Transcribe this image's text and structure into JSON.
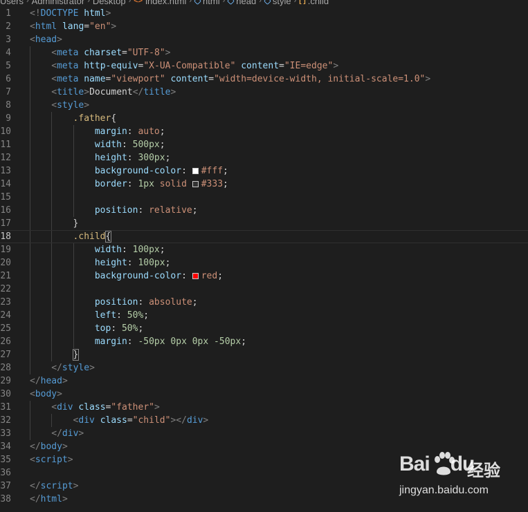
{
  "breadcrumb": {
    "items": [
      {
        "label": "Users",
        "icon": ""
      },
      {
        "label": "Administrator",
        "icon": ""
      },
      {
        "label": "Desktop",
        "icon": ""
      },
      {
        "label": "index.html",
        "icon": "html-file-icon"
      },
      {
        "label": "html",
        "icon": "element-icon"
      },
      {
        "label": "head",
        "icon": "element-icon"
      },
      {
        "label": "style",
        "icon": "element-icon"
      },
      {
        "label": ".child",
        "icon": "css-rule-icon"
      }
    ]
  },
  "editor": {
    "current_line": 18,
    "colors": {
      "background": "#1e1e1e",
      "tag": "#569cd6",
      "attribute": "#9cdcfe",
      "string": "#ce9178",
      "selector": "#d7ba7d",
      "number": "#b5cea8"
    },
    "lines": [
      {
        "n": "1",
        "indent": 0,
        "t": [
          [
            "br",
            "<!"
          ],
          [
            "tag",
            "DOCTYPE"
          ],
          [
            "txt",
            " "
          ],
          [
            "attr",
            "html"
          ],
          [
            "br",
            ">"
          ]
        ]
      },
      {
        "n": "2",
        "indent": 0,
        "t": [
          [
            "br",
            "<"
          ],
          [
            "tag",
            "html"
          ],
          [
            "txt",
            " "
          ],
          [
            "attr",
            "lang"
          ],
          [
            "txt",
            "="
          ],
          [
            "str",
            "\"en\""
          ],
          [
            "br",
            ">"
          ]
        ]
      },
      {
        "n": "3",
        "indent": 0,
        "t": [
          [
            "br",
            "<"
          ],
          [
            "tag",
            "head"
          ],
          [
            "br",
            ">"
          ]
        ]
      },
      {
        "n": "4",
        "indent": 1,
        "t": [
          [
            "br",
            "<"
          ],
          [
            "tag",
            "meta"
          ],
          [
            "txt",
            " "
          ],
          [
            "attr",
            "charset"
          ],
          [
            "txt",
            "="
          ],
          [
            "str",
            "\"UTF-8\""
          ],
          [
            "br",
            ">"
          ]
        ]
      },
      {
        "n": "5",
        "indent": 1,
        "t": [
          [
            "br",
            "<"
          ],
          [
            "tag",
            "meta"
          ],
          [
            "txt",
            " "
          ],
          [
            "attr",
            "http-equiv"
          ],
          [
            "txt",
            "="
          ],
          [
            "str",
            "\"X-UA-Compatible\""
          ],
          [
            "txt",
            " "
          ],
          [
            "attr",
            "content"
          ],
          [
            "txt",
            "="
          ],
          [
            "str",
            "\"IE=edge\""
          ],
          [
            "br",
            ">"
          ]
        ]
      },
      {
        "n": "6",
        "indent": 1,
        "t": [
          [
            "br",
            "<"
          ],
          [
            "tag",
            "meta"
          ],
          [
            "txt",
            " "
          ],
          [
            "attr",
            "name"
          ],
          [
            "txt",
            "="
          ],
          [
            "str",
            "\"viewport\""
          ],
          [
            "txt",
            " "
          ],
          [
            "attr",
            "content"
          ],
          [
            "txt",
            "="
          ],
          [
            "str",
            "\"width=device-width, initial-scale=1.0\""
          ],
          [
            "br",
            ">"
          ]
        ]
      },
      {
        "n": "7",
        "indent": 1,
        "t": [
          [
            "br",
            "<"
          ],
          [
            "tag",
            "title"
          ],
          [
            "br",
            ">"
          ],
          [
            "txt",
            "Document"
          ],
          [
            "br",
            "</"
          ],
          [
            "tag",
            "title"
          ],
          [
            "br",
            ">"
          ]
        ]
      },
      {
        "n": "8",
        "indent": 1,
        "t": [
          [
            "br",
            "<"
          ],
          [
            "tag",
            "style"
          ],
          [
            "br",
            ">"
          ]
        ]
      },
      {
        "n": "9",
        "indent": 2,
        "t": [
          [
            "sel",
            ".father"
          ],
          [
            "txt",
            "{"
          ]
        ]
      },
      {
        "n": "10",
        "indent": 3,
        "t": [
          [
            "prop",
            "margin"
          ],
          [
            "txt",
            ": "
          ],
          [
            "val",
            "auto"
          ],
          [
            "txt",
            ";"
          ]
        ]
      },
      {
        "n": "11",
        "indent": 3,
        "t": [
          [
            "prop",
            "width"
          ],
          [
            "txt",
            ": "
          ],
          [
            "num",
            "500px"
          ],
          [
            "txt",
            ";"
          ]
        ]
      },
      {
        "n": "12",
        "indent": 3,
        "t": [
          [
            "prop",
            "height"
          ],
          [
            "txt",
            ": "
          ],
          [
            "num",
            "300px"
          ],
          [
            "txt",
            ";"
          ]
        ]
      },
      {
        "n": "13",
        "indent": 3,
        "t": [
          [
            "prop",
            "background-color"
          ],
          [
            "txt",
            ": "
          ],
          [
            "swatch",
            "#ffffff"
          ],
          [
            "val",
            "#fff"
          ],
          [
            "txt",
            ";"
          ]
        ]
      },
      {
        "n": "14",
        "indent": 3,
        "t": [
          [
            "prop",
            "border"
          ],
          [
            "txt",
            ": "
          ],
          [
            "num",
            "1px"
          ],
          [
            "txt",
            " "
          ],
          [
            "val",
            "solid"
          ],
          [
            "txt",
            " "
          ],
          [
            "swatch",
            "#333333"
          ],
          [
            "val",
            "#333"
          ],
          [
            "txt",
            ";"
          ]
        ]
      },
      {
        "n": "15",
        "indent": 3,
        "t": []
      },
      {
        "n": "16",
        "indent": 3,
        "t": [
          [
            "prop",
            "position"
          ],
          [
            "txt",
            ": "
          ],
          [
            "val",
            "relative"
          ],
          [
            "txt",
            ";"
          ]
        ]
      },
      {
        "n": "17",
        "indent": 2,
        "t": [
          [
            "txt",
            "}"
          ]
        ]
      },
      {
        "n": "18",
        "indent": 2,
        "t": [
          [
            "sel",
            ".child"
          ],
          [
            "brace",
            "{"
          ]
        ]
      },
      {
        "n": "19",
        "indent": 3,
        "t": [
          [
            "prop",
            "width"
          ],
          [
            "txt",
            ": "
          ],
          [
            "num",
            "100px"
          ],
          [
            "txt",
            ";"
          ]
        ]
      },
      {
        "n": "20",
        "indent": 3,
        "t": [
          [
            "prop",
            "height"
          ],
          [
            "txt",
            ": "
          ],
          [
            "num",
            "100px"
          ],
          [
            "txt",
            ";"
          ]
        ]
      },
      {
        "n": "21",
        "indent": 3,
        "t": [
          [
            "prop",
            "background-color"
          ],
          [
            "txt",
            ": "
          ],
          [
            "swatch",
            "#ff0000"
          ],
          [
            "val",
            "red"
          ],
          [
            "txt",
            ";"
          ]
        ]
      },
      {
        "n": "22",
        "indent": 3,
        "t": []
      },
      {
        "n": "23",
        "indent": 3,
        "t": [
          [
            "prop",
            "position"
          ],
          [
            "txt",
            ": "
          ],
          [
            "val",
            "absolute"
          ],
          [
            "txt",
            ";"
          ]
        ]
      },
      {
        "n": "24",
        "indent": 3,
        "t": [
          [
            "prop",
            "left"
          ],
          [
            "txt",
            ": "
          ],
          [
            "num",
            "50%"
          ],
          [
            "txt",
            ";"
          ]
        ]
      },
      {
        "n": "25",
        "indent": 3,
        "t": [
          [
            "prop",
            "top"
          ],
          [
            "txt",
            ": "
          ],
          [
            "num",
            "50%"
          ],
          [
            "txt",
            ";"
          ]
        ]
      },
      {
        "n": "26",
        "indent": 3,
        "t": [
          [
            "prop",
            "margin"
          ],
          [
            "txt",
            ": "
          ],
          [
            "num",
            "-50px"
          ],
          [
            "txt",
            " "
          ],
          [
            "num",
            "0px"
          ],
          [
            "txt",
            " "
          ],
          [
            "num",
            "0px"
          ],
          [
            "txt",
            " "
          ],
          [
            "num",
            "-50px"
          ],
          [
            "txt",
            ";"
          ]
        ]
      },
      {
        "n": "27",
        "indent": 2,
        "t": [
          [
            "brace",
            "}"
          ]
        ]
      },
      {
        "n": "28",
        "indent": 1,
        "t": [
          [
            "br",
            "</"
          ],
          [
            "tag",
            "style"
          ],
          [
            "br",
            ">"
          ]
        ]
      },
      {
        "n": "29",
        "indent": 0,
        "t": [
          [
            "br",
            "</"
          ],
          [
            "tag",
            "head"
          ],
          [
            "br",
            ">"
          ]
        ]
      },
      {
        "n": "30",
        "indent": 0,
        "t": [
          [
            "br",
            "<"
          ],
          [
            "tag",
            "body"
          ],
          [
            "br",
            ">"
          ]
        ]
      },
      {
        "n": "31",
        "indent": 1,
        "t": [
          [
            "br",
            "<"
          ],
          [
            "tag",
            "div"
          ],
          [
            "txt",
            " "
          ],
          [
            "attr",
            "class"
          ],
          [
            "txt",
            "="
          ],
          [
            "str",
            "\"father\""
          ],
          [
            "br",
            ">"
          ]
        ]
      },
      {
        "n": "32",
        "indent": 2,
        "t": [
          [
            "br",
            "<"
          ],
          [
            "tag",
            "div"
          ],
          [
            "txt",
            " "
          ],
          [
            "attr",
            "class"
          ],
          [
            "txt",
            "="
          ],
          [
            "str",
            "\"child\""
          ],
          [
            "br",
            "></"
          ],
          [
            "tag",
            "div"
          ],
          [
            "br",
            ">"
          ]
        ]
      },
      {
        "n": "33",
        "indent": 1,
        "t": [
          [
            "br",
            "</"
          ],
          [
            "tag",
            "div"
          ],
          [
            "br",
            ">"
          ]
        ]
      },
      {
        "n": "34",
        "indent": 0,
        "t": [
          [
            "br",
            "</"
          ],
          [
            "tag",
            "body"
          ],
          [
            "br",
            ">"
          ]
        ]
      },
      {
        "n": "35",
        "indent": 0,
        "t": [
          [
            "br",
            "<"
          ],
          [
            "tag",
            "script"
          ],
          [
            "br",
            ">"
          ]
        ]
      },
      {
        "n": "36",
        "indent": 0,
        "t": []
      },
      {
        "n": "37",
        "indent": 0,
        "t": [
          [
            "br",
            "</"
          ],
          [
            "tag",
            "script"
          ],
          [
            "br",
            ">"
          ]
        ]
      },
      {
        "n": "38",
        "indent": 0,
        "t": [
          [
            "br",
            "</"
          ],
          [
            "tag",
            "html"
          ],
          [
            "br",
            ">"
          ]
        ]
      }
    ]
  },
  "watermark": {
    "brand": "Bai",
    "brand_suffix": "du",
    "cn": "经验",
    "url": "jingyan.baidu.com"
  }
}
